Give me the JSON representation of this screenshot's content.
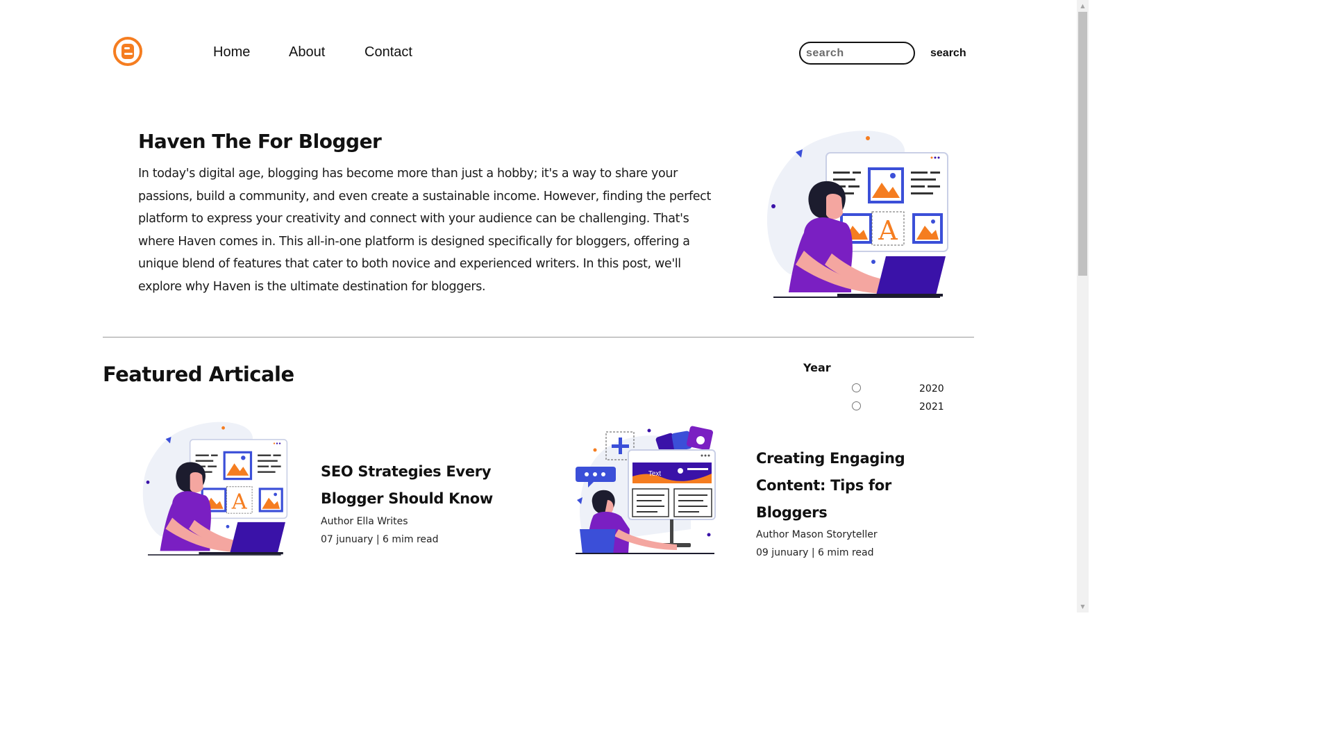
{
  "header": {
    "logo_icon": "blogger-logo-icon",
    "nav": [
      {
        "label": "Home"
      },
      {
        "label": "About"
      },
      {
        "label": "Contact"
      }
    ],
    "search": {
      "placeholder": "search",
      "value": "",
      "button_label": "search"
    }
  },
  "hero": {
    "title": "Haven The For Blogger",
    "text": "In today's digital age, blogging has become more than just a hobby; it's a way to share your passions, build a community, and even create a sustainable income. However, finding the perfect platform to express your creativity and connect with your audience can be challenging. That's where Haven comes in. This all-in-one platform is designed specifically for bloggers, offering a unique blend of features that cater to both novice and experienced writers. In this post, we'll explore why Haven is the ultimate destination for bloggers.",
    "illustration_icon": "blogger-designing-illustration"
  },
  "featured": {
    "heading": "Featured Articale",
    "filter": {
      "label": "Year",
      "options": [
        {
          "label": "2020",
          "selected": false
        },
        {
          "label": "2021",
          "selected": false
        }
      ]
    },
    "articles": [
      {
        "title": "SEO Strategies Every Blogger Should Know",
        "author": "Author Ella Writes",
        "date_read": "07 junuary | 6 mim read",
        "illustration_icon": "blogger-designing-illustration"
      },
      {
        "title": "Creating Engaging Content: Tips for Bloggers",
        "author": "Author Mason Storyteller",
        "date_read": "09 junuary | 6 mim read",
        "illustration_icon": "content-creator-illustration",
        "illustration_text": "Text"
      }
    ]
  },
  "colors": {
    "accent_orange": "#f57d20",
    "illustration_purple": "#7a1fc2",
    "illustration_blue": "#3b4fd8",
    "laptop_indigo": "#3a12a8"
  }
}
